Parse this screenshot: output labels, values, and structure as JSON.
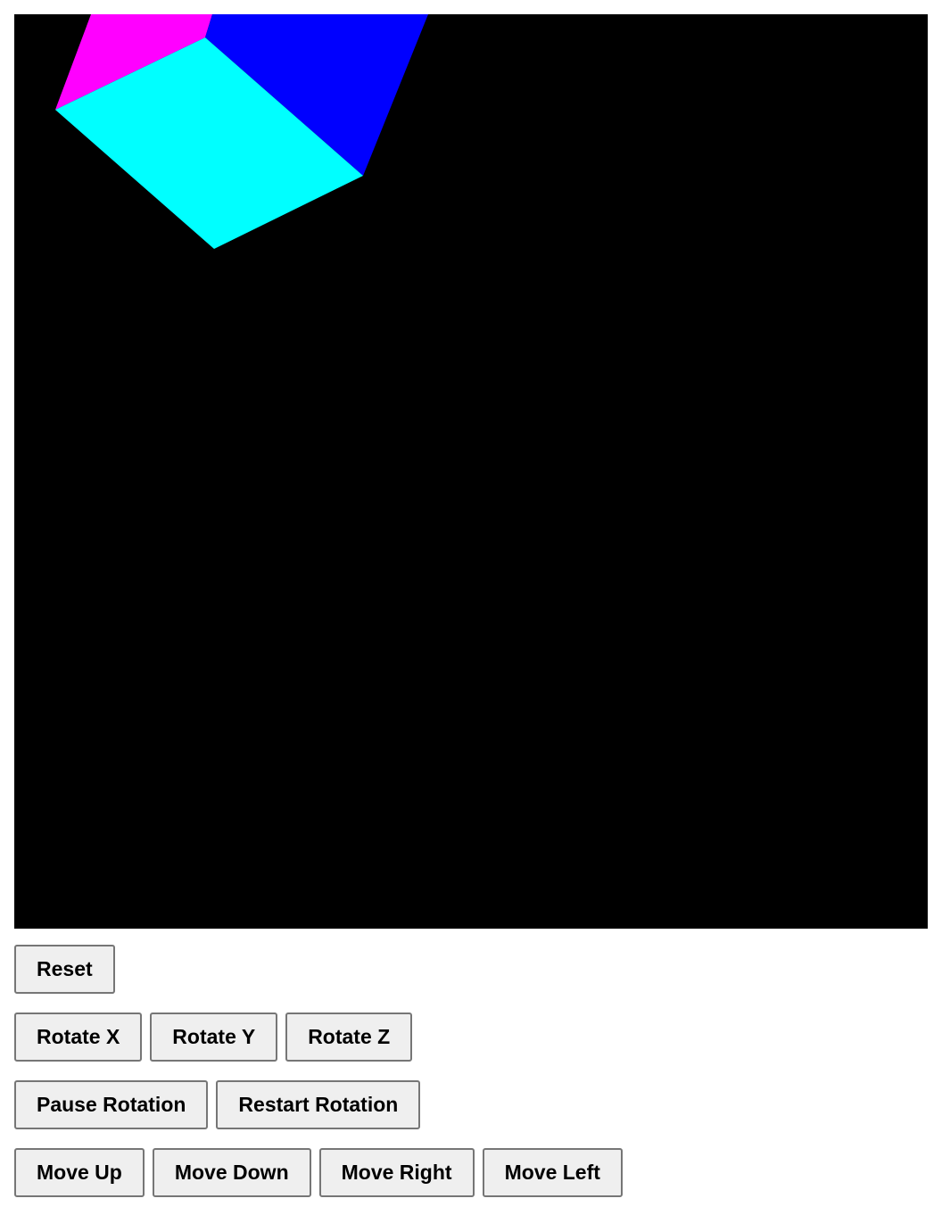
{
  "scene": {
    "background_color": "#000000",
    "cube_face_colors": {
      "front": "#00ffff",
      "right": "#0000ff",
      "left": "#ff00ff"
    }
  },
  "controls": {
    "reset": "Reset",
    "rotate_x": "Rotate X",
    "rotate_y": "Rotate Y",
    "rotate_z": "Rotate Z",
    "pause_rotation": "Pause Rotation",
    "restart_rotation": "Restart Rotation",
    "move_up": "Move Up",
    "move_down": "Move Down",
    "move_right": "Move Right",
    "move_left": "Move Left"
  }
}
